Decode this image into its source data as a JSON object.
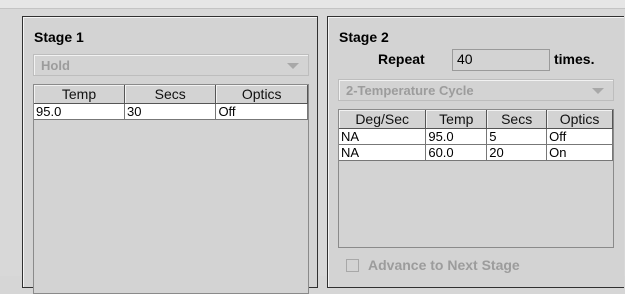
{
  "stage1": {
    "title": "Stage 1",
    "step_type": "Hold",
    "columns": [
      "Temp",
      "Secs",
      "Optics"
    ],
    "rows": [
      [
        "95.0",
        "30",
        "Off"
      ]
    ]
  },
  "stage2": {
    "title": "Stage 2",
    "repeat_label": "Repeat",
    "repeat_value": "40",
    "times_label": "times.",
    "step_type": "2-Temperature Cycle",
    "columns": [
      "Deg/Sec",
      "Temp",
      "Secs",
      "Optics"
    ],
    "rows": [
      [
        "NA",
        "95.0",
        "5",
        "Off"
      ],
      [
        "NA",
        "60.0",
        "20",
        "On"
      ]
    ],
    "advance_label": "Advance to Next Stage"
  }
}
